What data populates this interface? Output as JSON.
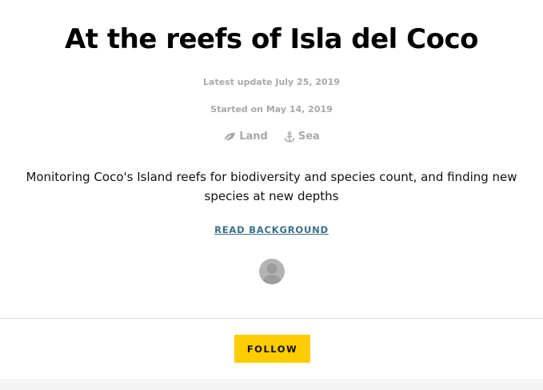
{
  "header": {
    "title": "At the reefs of Isla del Coco"
  },
  "meta": {
    "latest_update": "Latest update July 25, 2019",
    "started": "Started on May 14, 2019"
  },
  "tags": [
    {
      "label": "Land",
      "icon": "leaf-icon"
    },
    {
      "label": "Sea",
      "icon": "anchor-icon"
    }
  ],
  "description": "Monitoring Coco's Island reefs for biodiversity and species count, and finding new species at new depths",
  "links": {
    "read_background": "READ BACKGROUND"
  },
  "actions": {
    "follow": "FOLLOW"
  },
  "colors": {
    "accent": "#ffcc00",
    "link": "#3a6f88",
    "muted": "#a8a8a8",
    "avatar": "#b3b3b3"
  }
}
